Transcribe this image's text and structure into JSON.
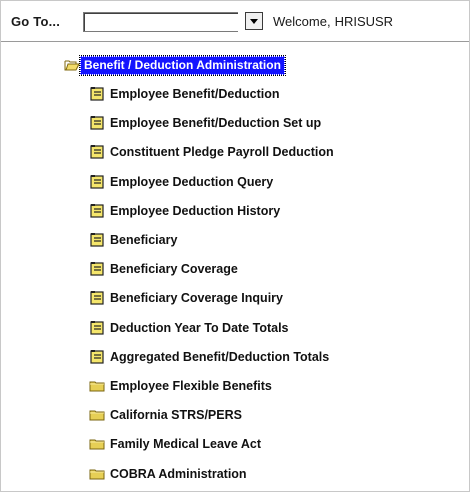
{
  "goto": {
    "label": "Go To...",
    "input_value": "",
    "welcome_text": "Welcome,",
    "username": "HRISUSR"
  },
  "tree": {
    "root": {
      "label": "Benefit / Deduction Administration",
      "icon": "open-folder-icon"
    },
    "items": [
      {
        "label": "Employee Benefit/Deduction",
        "icon": "document-icon"
      },
      {
        "label": "Employee Benefit/Deduction Set up",
        "icon": "document-icon"
      },
      {
        "label": "Constituent Pledge Payroll Deduction",
        "icon": "document-icon"
      },
      {
        "label": "Employee Deduction Query",
        "icon": "document-icon"
      },
      {
        "label": "Employee Deduction History",
        "icon": "document-icon"
      },
      {
        "label": "Beneficiary",
        "icon": "document-icon"
      },
      {
        "label": "Beneficiary Coverage",
        "icon": "document-icon"
      },
      {
        "label": "Beneficiary Coverage Inquiry",
        "icon": "document-icon"
      },
      {
        "label": "Deduction Year To Date Totals",
        "icon": "document-icon"
      },
      {
        "label": "Aggregated Benefit/Deduction Totals",
        "icon": "document-icon"
      },
      {
        "label": "Employee Flexible Benefits",
        "icon": "folder-icon"
      },
      {
        "label": "California STRS/PERS",
        "icon": "folder-icon"
      },
      {
        "label": "Family Medical Leave Act",
        "icon": "folder-icon"
      },
      {
        "label": "COBRA Administration",
        "icon": "folder-icon"
      }
    ]
  },
  "colors": {
    "selection": "#1414ff",
    "document_icon": "#f5e66b",
    "folder_icon": "#e6cf55"
  }
}
